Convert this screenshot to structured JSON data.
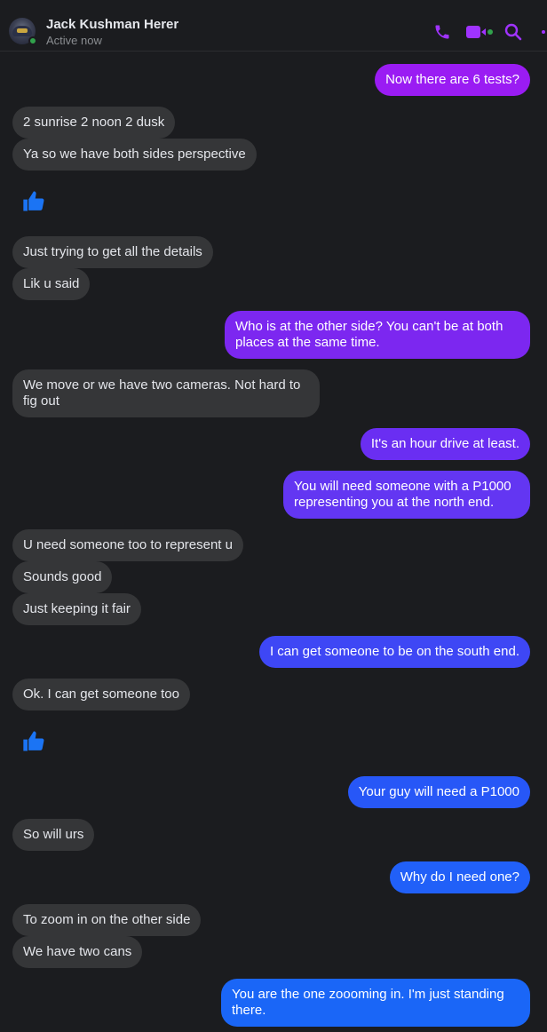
{
  "header": {
    "contact_name": "Jack Kushman Herer",
    "status": "Active now",
    "icons": [
      "phone-icon",
      "video-call-icon",
      "search-icon",
      "more-icon"
    ],
    "accent": "#a033ff"
  },
  "messages": [
    {
      "dir": "out",
      "text": "Now there are 6 tests?",
      "color": "#9a1cf3"
    },
    {
      "dir": "in",
      "text": "2 sunrise 2 noon 2 dusk"
    },
    {
      "dir": "in",
      "text": "Ya so we have both sides perspective"
    },
    {
      "dir": "in",
      "type": "like",
      "text": "thumbs-up"
    },
    {
      "dir": "in",
      "text": "Just trying to get all the details"
    },
    {
      "dir": "in",
      "text": "Lik u said"
    },
    {
      "dir": "out",
      "text": "Who is at the other side?  You can't be at both places at the same time.",
      "color": "#7c27f0"
    },
    {
      "dir": "in",
      "text": "We move or we have two cameras. Not hard to fig out"
    },
    {
      "dir": "out",
      "text": "It's an hour drive at least.",
      "color": "#6a2ef2"
    },
    {
      "dir": "out",
      "text": "You will need someone with a P1000 representing you at the north end.",
      "color": "#6336f2"
    },
    {
      "dir": "in",
      "text": "U need someone too to represent u"
    },
    {
      "dir": "in",
      "text": "Sounds good"
    },
    {
      "dir": "in",
      "text": "Just keeping it fair"
    },
    {
      "dir": "out",
      "text": "I can get someone to be on the south end.",
      "color": "#3e47f5"
    },
    {
      "dir": "in",
      "text": "Ok. I can get someone too"
    },
    {
      "dir": "in",
      "type": "like",
      "text": "thumbs-up"
    },
    {
      "dir": "out",
      "text": "Your guy will need a P1000",
      "color": "#2757f7"
    },
    {
      "dir": "in",
      "text": "So will urs"
    },
    {
      "dir": "out",
      "text": "Why do I need one?",
      "color": "#2160f8"
    },
    {
      "dir": "in",
      "text": "To zoom in on the other side"
    },
    {
      "dir": "in",
      "text": "We have two cans"
    },
    {
      "dir": "out",
      "text": "You are the one zoooming in.  I'm just standing there.",
      "color": "#1a66f7"
    }
  ]
}
